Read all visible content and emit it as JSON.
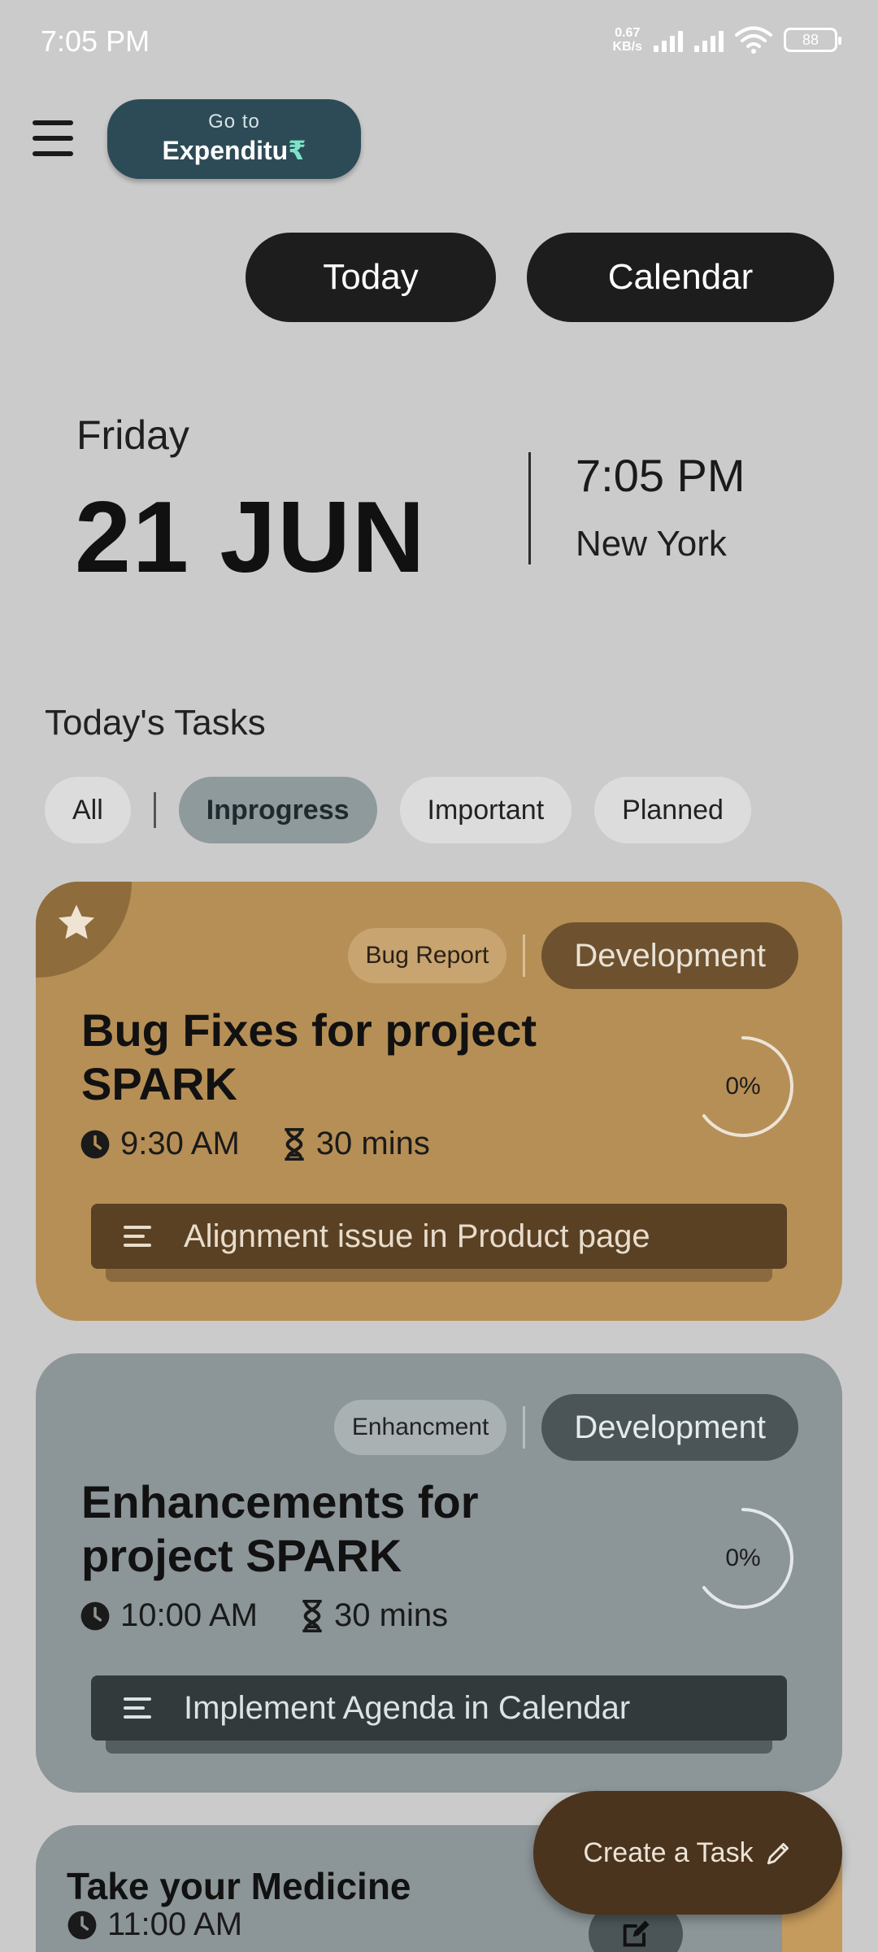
{
  "status_bar": {
    "time": "7:05 PM",
    "net_speed_value": "0.67",
    "net_speed_unit": "KB/s",
    "battery": "88"
  },
  "header": {
    "goto_small": "Go to",
    "goto_big": "Expenditu",
    "goto_symbol": "₹"
  },
  "nav": {
    "today_label": "Today",
    "calendar_label": "Calendar"
  },
  "date_block": {
    "day": "Friday",
    "date": "21 JUN",
    "time": "7:05 PM",
    "city": "New York"
  },
  "tasks": {
    "heading": "Today's Tasks",
    "filters": [
      "All",
      "Inprogress",
      "Important",
      "Planned"
    ],
    "active_filter": "Inprogress",
    "cards": [
      {
        "category": "Bug Report",
        "team": "Development",
        "title": "Bug Fixes for project SPARK",
        "time": "9:30 AM",
        "duration": "30 mins",
        "progress": "0%",
        "subtask": "Alignment issue in Product page",
        "starred": true,
        "color": "#b68f56"
      },
      {
        "category": "Enhancment",
        "team": "Development",
        "title": "Enhancements for project SPARK",
        "time": "10:00 AM",
        "duration": "30 mins",
        "progress": "0%",
        "subtask": "Implement Agenda in Calendar",
        "starred": false,
        "color": "#8c9598"
      },
      {
        "title": "Take your Medicine",
        "time": "11:00 AM",
        "color": "#8c9598"
      }
    ]
  },
  "fab": {
    "label": "Create a Task"
  },
  "icons": {
    "menu": "hamburger-icon",
    "star": "star-icon",
    "clock": "clock-icon",
    "hourglass": "hourglass-icon",
    "list": "list-icon",
    "edit": "edit-icon",
    "pencil": "pencil-icon"
  }
}
